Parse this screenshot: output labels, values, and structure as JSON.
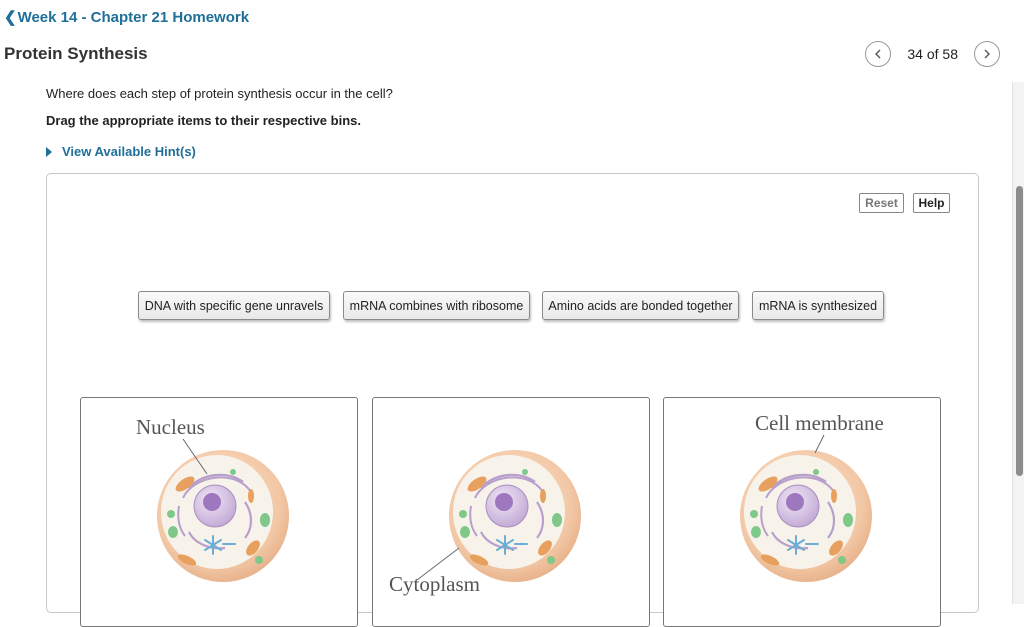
{
  "header": {
    "back_label": "Week 14 - Chapter 21 Homework",
    "back_icon": "chevron-left-icon",
    "title": "Protein Synthesis",
    "pager": {
      "current_text": "34 of 58",
      "prev_icon": "chevron-left-icon",
      "next_icon": "chevron-right-icon"
    }
  },
  "question": {
    "prompt": "Where does each step of protein synthesis occur in the cell?",
    "instruction": "Drag the appropriate items to their respective bins.",
    "hints_label": "View Available Hint(s)"
  },
  "workspace": {
    "reset_label": "Reset",
    "help_label": "Help",
    "items": [
      "DNA with specific gene unravels",
      "mRNA combines with ribosome",
      "Amino acids are bonded together",
      "mRNA is synthesized"
    ],
    "bins": [
      {
        "label": "Nucleus"
      },
      {
        "label": "Cytoplasm"
      },
      {
        "label": "Cell membrane"
      }
    ]
  },
  "colors": {
    "link": "#1f6f98",
    "cell_membrane": "#f3cdb0",
    "cytoplasm": "#f6f1e6",
    "nucleus": "#c9b3d9",
    "nucleolus": "#a77fc4",
    "organelle_green": "#7fc88a",
    "organelle_orange": "#e39a55"
  }
}
